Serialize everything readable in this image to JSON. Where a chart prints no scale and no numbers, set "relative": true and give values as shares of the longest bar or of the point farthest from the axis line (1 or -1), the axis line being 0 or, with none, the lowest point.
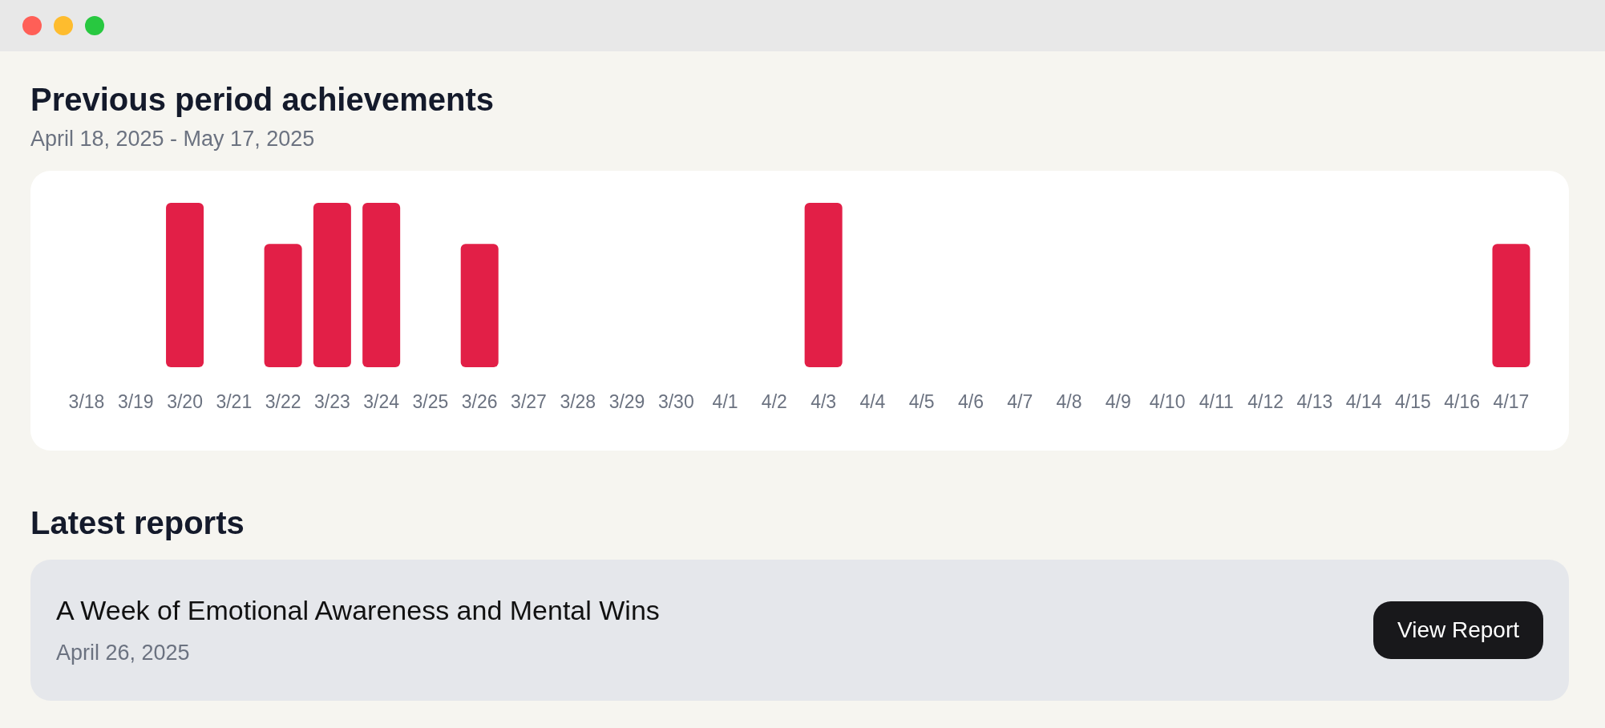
{
  "window": {
    "controls": [
      {
        "color": "#ff5f57"
      },
      {
        "color": "#febc2e"
      },
      {
        "color": "#28c840"
      }
    ]
  },
  "achievements": {
    "title": "Previous period achievements",
    "date_range": "April 18, 2025 - May 17, 2025",
    "chart_data": {
      "type": "bar",
      "relative": true,
      "categories": [
        "3/18",
        "3/19",
        "3/20",
        "3/21",
        "3/22",
        "3/23",
        "3/24",
        "3/25",
        "3/26",
        "3/27",
        "3/28",
        "3/29",
        "3/30",
        "4/1",
        "4/2",
        "4/3",
        "4/4",
        "4/5",
        "4/6",
        "4/7",
        "4/8",
        "4/9",
        "4/10",
        "4/11",
        "4/12",
        "4/13",
        "4/14",
        "4/15",
        "4/16",
        "4/17"
      ],
      "series": [
        {
          "color": "#e21f47",
          "values": [
            0,
            0,
            1,
            0,
            0.75,
            1,
            1,
            0,
            0.75,
            0,
            0,
            0,
            0,
            0,
            0,
            1,
            0,
            0,
            0,
            0,
            0,
            0,
            0,
            0,
            0,
            0,
            0,
            0,
            0,
            0.75
          ]
        }
      ]
    }
  },
  "reports": {
    "title": "Latest reports",
    "items": [
      {
        "title": "A Week of Emotional Awareness and Mental Wins",
        "date": "April 26, 2025",
        "button": "View Report"
      }
    ]
  }
}
